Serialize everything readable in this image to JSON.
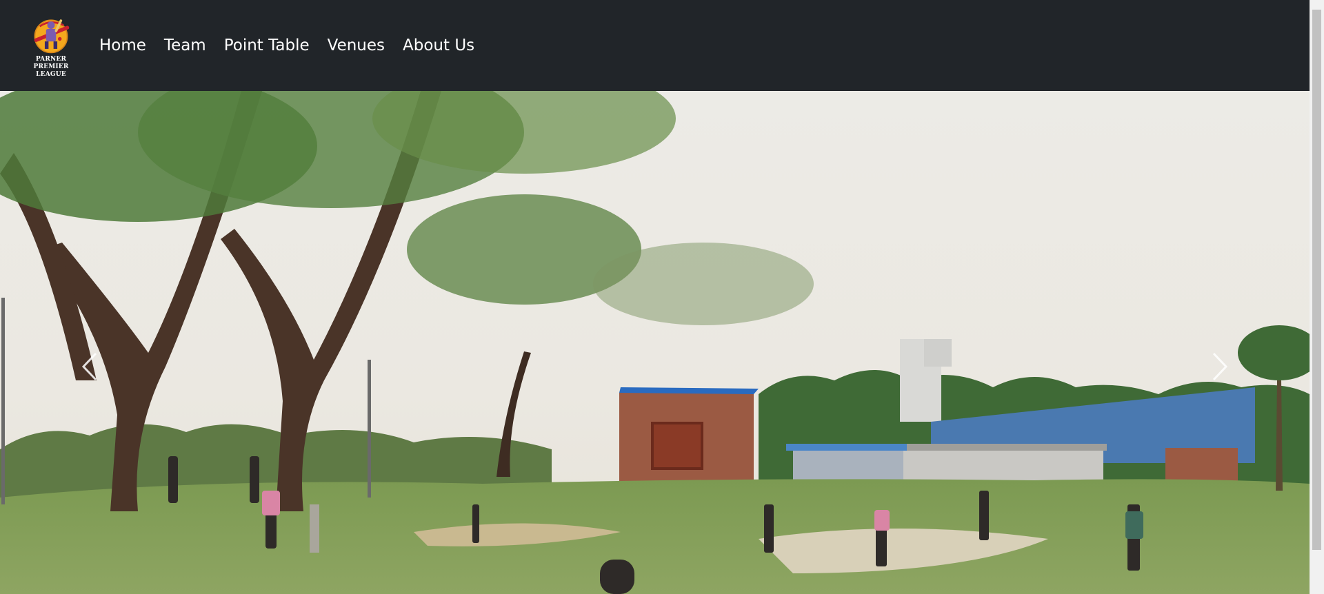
{
  "brand": {
    "logo_icon": "cricket-batsman-logo-icon",
    "name_line1": "PARNER PREMIER",
    "name_line2": "LEAGUE"
  },
  "nav": {
    "items": [
      {
        "label": "Home"
      },
      {
        "label": "Team"
      },
      {
        "label": "Point Table"
      },
      {
        "label": "Venues"
      },
      {
        "label": "About Us"
      }
    ]
  },
  "carousel": {
    "image_subject": "children-playing-cricket-photo",
    "prev_icon": "chevron-left-icon",
    "next_icon": "chevron-right-icon"
  },
  "colors": {
    "navbar_bg": "#212529",
    "nav_text": "#ffffff",
    "scrollbar_track": "#f1f1f1",
    "scrollbar_thumb": "#c1c1c1"
  }
}
